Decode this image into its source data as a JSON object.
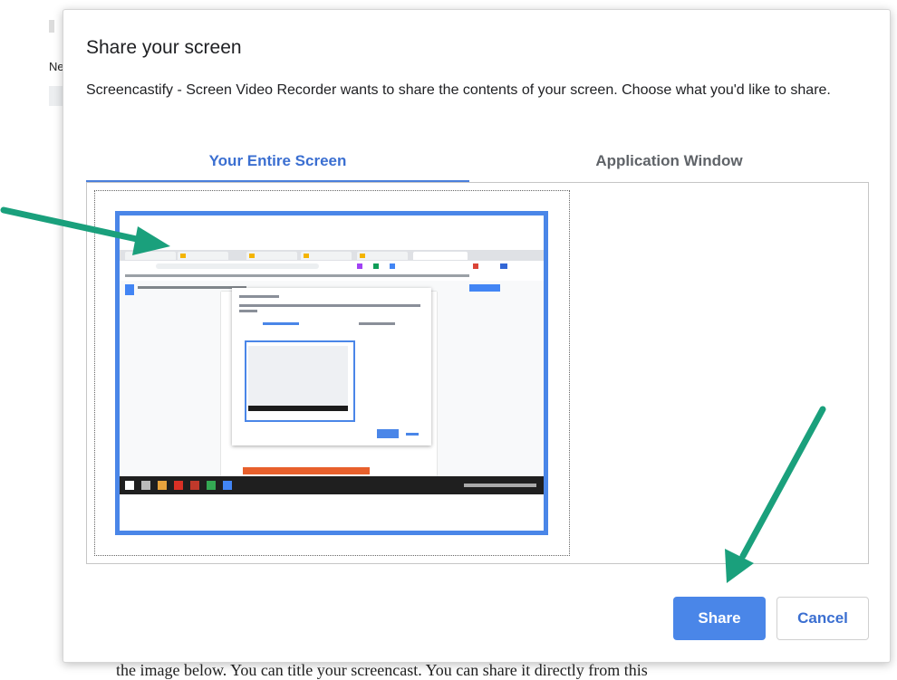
{
  "background": {
    "nav_text": "Ne",
    "body_text": "the image below.  You can title your screencast.  You can share it directly from this"
  },
  "dialog": {
    "title": "Share your screen",
    "description": "Screencastify - Screen Video Recorder wants to share the contents of your screen. Choose what you'd like to share.",
    "tabs": [
      {
        "label": "Your Entire Screen",
        "selected": true
      },
      {
        "label": "Application Window",
        "selected": false
      }
    ],
    "share_label": "Share",
    "cancel_label": "Cancel"
  },
  "colors": {
    "accent": "#4a86e8",
    "tab_active_text": "#3b6fd1",
    "annotation_arrow": "#1aa07c"
  },
  "icons": [
    "annotation-arrow-icon"
  ]
}
